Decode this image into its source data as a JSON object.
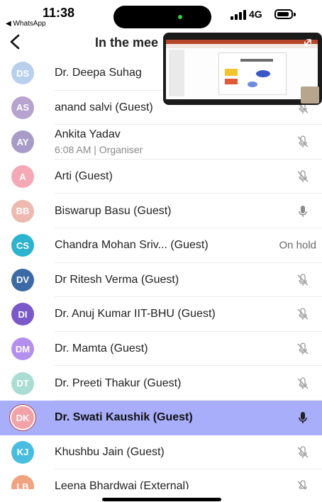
{
  "status_bar": {
    "time": "11:38",
    "back_app": "◀ WhatsApp",
    "network": "4G",
    "signal_icon": "cellular-signal-icon",
    "battery_icon": "battery-icon",
    "island_dot_color": "#2ed14a"
  },
  "header": {
    "back_icon": "chevron-left-icon",
    "title": "In the mee"
  },
  "video_tile": {
    "content": "shared-screen-presentation",
    "expand_icon": "expand-icon"
  },
  "participants": [
    {
      "initials": "DS",
      "name": "Dr. Deepa Suhag",
      "sub": "",
      "status": "",
      "mic": "none",
      "color": "#b8cfee"
    },
    {
      "initials": "AS",
      "name": "anand salvi (Guest)",
      "sub": "",
      "status": "",
      "mic": "muted",
      "color": "#b7a3cf"
    },
    {
      "initials": "AY",
      "name": "Ankita Yadav",
      "sub": "6:08 AM | Organiser",
      "status": "",
      "mic": "muted",
      "color": "#a99bc8"
    },
    {
      "initials": "A",
      "name": "Arti  (Guest)",
      "sub": "",
      "status": "",
      "mic": "muted",
      "color": "#f5a9b7"
    },
    {
      "initials": "BB",
      "name": "Biswarup Basu (Guest)",
      "sub": "",
      "status": "",
      "mic": "on",
      "color": "#edb9b0"
    },
    {
      "initials": "CS",
      "name": "Chandra Mohan Sriv...   (Guest)",
      "sub": "",
      "status": "On hold",
      "mic": "none",
      "color": "#2bb3cf"
    },
    {
      "initials": "DV",
      "name": "Dr Ritesh Verma (Guest)",
      "sub": "",
      "status": "",
      "mic": "muted",
      "color": "#3c6aa6"
    },
    {
      "initials": "DI",
      "name": "Dr. Anuj Kumar IIT-BHU  (Guest)",
      "sub": "",
      "status": "",
      "mic": "muted",
      "color": "#7b58c7"
    },
    {
      "initials": "DM",
      "name": "Dr. Mamta (Guest)",
      "sub": "",
      "status": "",
      "mic": "muted",
      "color": "#b48ff0"
    },
    {
      "initials": "DT",
      "name": "Dr. Preeti Thakur (Guest)",
      "sub": "",
      "status": "",
      "mic": "muted",
      "color": "#a9ddd3"
    },
    {
      "initials": "DK",
      "name": "Dr. Swati Kaushik (Guest)",
      "sub": "",
      "status": "",
      "mic": "on-active",
      "color": "#f2a2a8",
      "selected": true
    },
    {
      "initials": "KJ",
      "name": "Khushbu Jain (Guest)",
      "sub": "",
      "status": "",
      "mic": "muted",
      "color": "#48bde0"
    },
    {
      "initials": "LB",
      "name": "Leena Bhardwaj (External)",
      "sub": "",
      "status": "",
      "mic": "muted",
      "color": "#f0a37e"
    }
  ]
}
